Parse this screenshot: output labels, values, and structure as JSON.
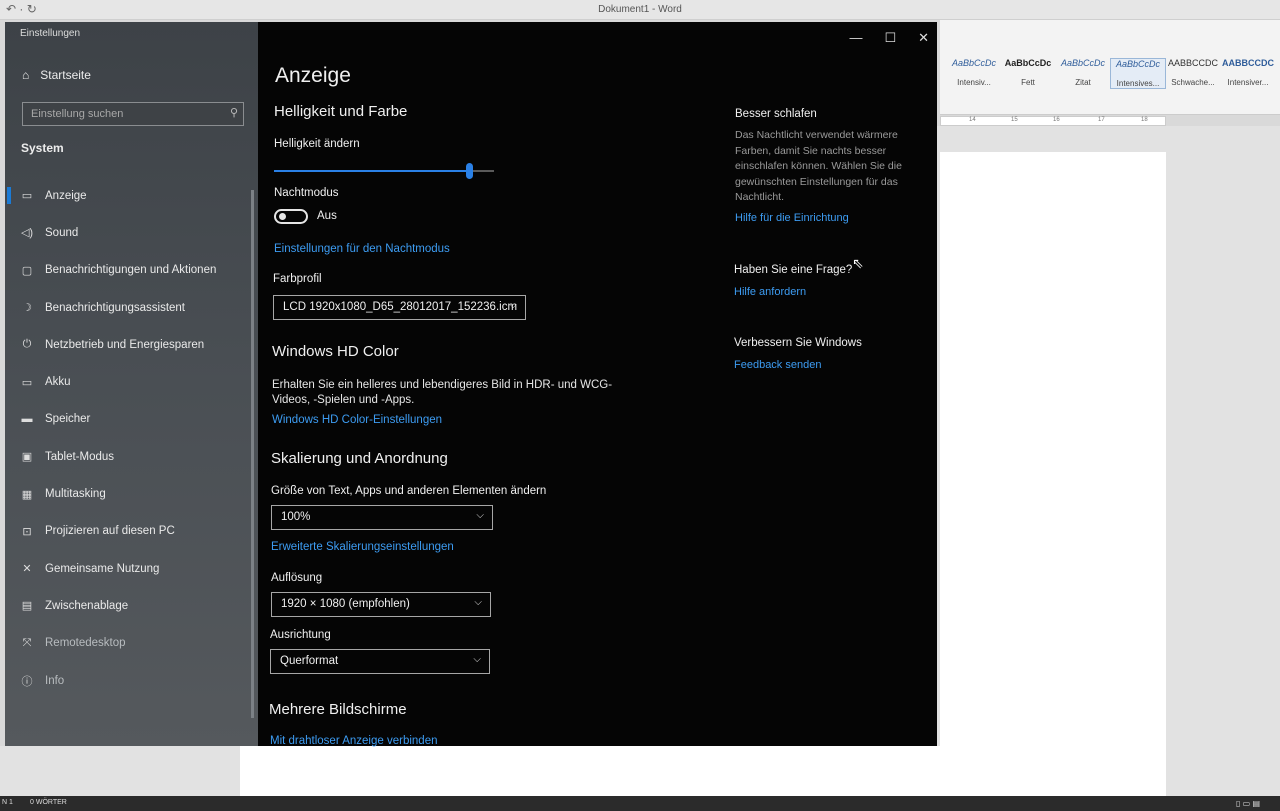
{
  "word": {
    "title": "Dokument1 - Word",
    "styles": [
      {
        "preview": "AaBbCcDc",
        "name": "Intensiv..."
      },
      {
        "preview": "AaBbCcDc",
        "name": "Fett"
      },
      {
        "preview": "AaBbCcDc",
        "name": "Zitat"
      },
      {
        "preview": "AaBbCcDc",
        "name": "Intensives..."
      },
      {
        "preview": "AABBCCDC",
        "name": "Schwache..."
      },
      {
        "preview": "AABBCCDC",
        "name": "Intensiver..."
      }
    ],
    "ruler": [
      "14",
      "15",
      "16",
      "17",
      "18"
    ],
    "status": {
      "page": "N 1",
      "words": "0 WÖRTER"
    }
  },
  "settings": {
    "window_title": "Einstellungen",
    "home_label": "Startseite",
    "search_placeholder": "Einstellung suchen",
    "category": "System",
    "nav": [
      {
        "label": "Anzeige",
        "icon": "monitor-icon",
        "active": true
      },
      {
        "label": "Sound",
        "icon": "speaker-icon"
      },
      {
        "label": "Benachrichtigungen und Aktionen",
        "icon": "notification-icon"
      },
      {
        "label": "Benachrichtigungsassistent",
        "icon": "moon-icon"
      },
      {
        "label": "Netzbetrieb und Energiesparen",
        "icon": "power-icon"
      },
      {
        "label": "Akku",
        "icon": "battery-icon"
      },
      {
        "label": "Speicher",
        "icon": "storage-icon"
      },
      {
        "label": "Tablet-Modus",
        "icon": "tablet-icon"
      },
      {
        "label": "Multitasking",
        "icon": "multitasking-icon"
      },
      {
        "label": "Projizieren auf diesen PC",
        "icon": "project-icon"
      },
      {
        "label": "Gemeinsame Nutzung",
        "icon": "share-icon"
      },
      {
        "label": "Zwischenablage",
        "icon": "clipboard-icon"
      },
      {
        "label": "Remotedesktop",
        "icon": "remote-icon"
      },
      {
        "label": "Info",
        "icon": "info-icon"
      }
    ],
    "main": {
      "title": "Anzeige",
      "brightness_section": "Helligkeit und Farbe",
      "brightness_label": "Helligkeit ändern",
      "brightness_value": 0.89,
      "night_label": "Nachtmodus",
      "night_state": "Aus",
      "night_link": "Einstellungen für den Nachtmodus",
      "color_profile_label": "Farbprofil",
      "color_profile_value": "LCD 1920x1080_D65_28012017_152236.icm",
      "hdr_section": "Windows HD Color",
      "hdr_text": "Erhalten Sie ein helleres und lebendigeres Bild in HDR- und WCG-Videos, -Spielen und -Apps.",
      "hdr_link": "Windows HD Color-Einstellungen",
      "scale_section": "Skalierung und Anordnung",
      "scale_label": "Größe von Text, Apps und anderen Elementen ändern",
      "scale_value": "100%",
      "scale_link": "Erweiterte Skalierungseinstellungen",
      "resolution_label": "Auflösung",
      "resolution_value": "1920 × 1080 (empfohlen)",
      "orientation_label": "Ausrichtung",
      "orientation_value": "Querformat",
      "multi_section": "Mehrere Bildschirme",
      "wireless_link": "Mit drahtloser Anzeige verbinden"
    },
    "aside": {
      "sleep_title": "Besser schlafen",
      "sleep_text": "Das Nachtlicht verwendet wärmere Farben, damit Sie nachts besser einschlafen können. Wählen Sie die gewünschten Einstellungen für das Nachtlicht.",
      "sleep_link": "Hilfe für die Einrichtung",
      "question_title": "Haben Sie eine Frage?",
      "question_link": "Hilfe anfordern",
      "improve_title": "Verbessern Sie Windows",
      "improve_link": "Feedback senden"
    }
  }
}
